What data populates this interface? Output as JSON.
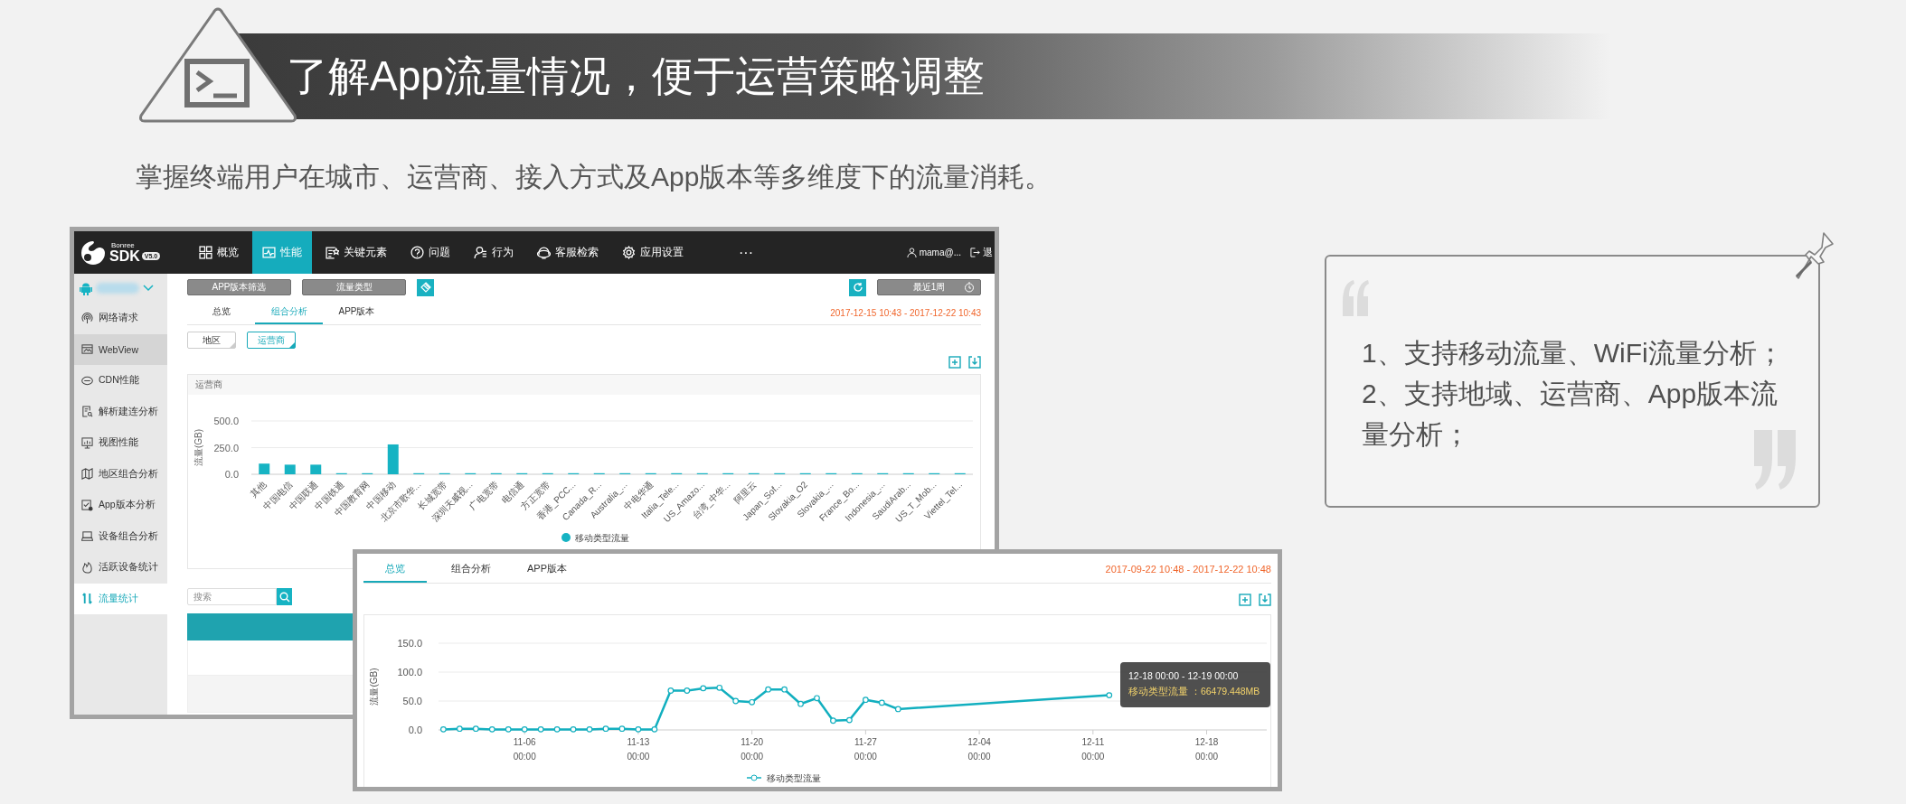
{
  "headline": {
    "title": "了解App流量情况，便于运营策略调整",
    "subtitle": "掌握终端用户在城市、运营商、接入方式及App版本等多维度下的流量消耗。"
  },
  "back_window": {
    "logo": {
      "brand": "Bonree",
      "product": "SDK",
      "version": "V5.0"
    },
    "nav": [
      {
        "label": "概览",
        "selected": false
      },
      {
        "label": "性能",
        "selected": true
      },
      {
        "label": "关键元素",
        "selected": false
      },
      {
        "label": "问题",
        "selected": false
      },
      {
        "label": "行为",
        "selected": false
      },
      {
        "label": "客服检索",
        "selected": false
      },
      {
        "label": "应用设置",
        "selected": false
      }
    ],
    "more": "···",
    "user": "mama@...",
    "logout": "退",
    "sidebar": {
      "items": [
        {
          "label": "网络请求",
          "selected": false,
          "hovered": false
        },
        {
          "label": "WebView",
          "selected": false,
          "hovered": true
        },
        {
          "label": "CDN性能",
          "selected": false,
          "hovered": false
        },
        {
          "label": "解析建连分析",
          "selected": false,
          "hovered": false
        },
        {
          "label": "视图性能",
          "selected": false,
          "hovered": false
        },
        {
          "label": "地区组合分析",
          "selected": false,
          "hovered": false
        },
        {
          "label": "App版本分析",
          "selected": false,
          "hovered": false
        },
        {
          "label": "设备组合分析",
          "selected": false,
          "hovered": false
        },
        {
          "label": "活跃设备统计",
          "selected": false,
          "hovered": false
        },
        {
          "label": "流量统计",
          "selected": true,
          "hovered": false
        }
      ]
    },
    "filters": [
      "APP版本筛选",
      "流量类型"
    ],
    "range": "最近1周",
    "tabs": [
      {
        "label": "总览",
        "selected": false
      },
      {
        "label": "组合分析",
        "selected": true
      },
      {
        "label": "APP版本",
        "selected": false
      }
    ],
    "date_range": "2017-12-15 10:43 - 2017-12-22 10:43",
    "chips": [
      {
        "label": "地区",
        "selected": false
      },
      {
        "label": "运营商",
        "selected": true
      }
    ],
    "chart_card": {
      "title": "运营商",
      "chart_data": {
        "type": "bar",
        "ylabel": "流量(GB)",
        "categories": [
          "其他",
          "中国电信",
          "中国联通",
          "中国铁通",
          "中国教育网",
          "中国移动",
          "北京市歌华...",
          "长城宽带",
          "深圳天威视...",
          "广电宽带",
          "电信通",
          "方正宽带",
          "香港_PCC...",
          "Canada_R...",
          "Australia_...",
          "中电华通",
          "Italia_Tele...",
          "US_Amazo...",
          "台湾_中华...",
          "阿里云",
          "Japan_Sof...",
          "Slovakia_O2",
          "Slovakia_...",
          "France_Bo...",
          "Indonesia_...",
          "SaudiArab...",
          "US_T_Mob...",
          "Viettel_Tel..."
        ],
        "series": [
          {
            "name": "移动类型流量",
            "color": "#16b3c3",
            "values": [
              100,
              90,
              90,
              10,
              10,
              280,
              10,
              10,
              10,
              10,
              10,
              10,
              10,
              10,
              10,
              10,
              10,
              10,
              10,
              10,
              10,
              10,
              10,
              10,
              10,
              10,
              10,
              10
            ]
          }
        ],
        "ylim": [
          0,
          500
        ],
        "yticks": [
          {
            "value": 0,
            "label": "0.0"
          },
          {
            "value": 250,
            "label": "250.0"
          },
          {
            "value": 500,
            "label": "500.0"
          }
        ]
      }
    },
    "search": {
      "placeholder": "搜索"
    }
  },
  "front_window": {
    "tabs": [
      {
        "label": "总览",
        "selected": true
      },
      {
        "label": "组合分析",
        "selected": false
      },
      {
        "label": "APP版本",
        "selected": false
      }
    ],
    "date_range": "2017-09-22 10:48 - 2017-12-22 10:48",
    "chart_data": {
      "type": "line",
      "ylabel": "流量(GB)",
      "categories": [
        null,
        null,
        null,
        null,
        null,
        "11-06 00:00",
        null,
        null,
        null,
        null,
        null,
        null,
        "11-13 00:00",
        null,
        null,
        null,
        null,
        null,
        null,
        "11-20 00:00",
        null,
        null,
        null,
        null,
        null,
        null,
        "11-27 00:00",
        null,
        null,
        null,
        null,
        null,
        null,
        "12-04 00:00",
        null,
        null,
        null,
        null,
        null,
        null,
        "12-11 00:00",
        null,
        null,
        null,
        null,
        null,
        null,
        "12-18 00:00",
        null,
        null,
        null
      ],
      "series": [
        {
          "name": "移动类型流量",
          "color": "#12afbf",
          "marker": "circle",
          "values": [
            1,
            2,
            2,
            1,
            1,
            1,
            1,
            1,
            1,
            1,
            2,
            2,
            1,
            1,
            68,
            68,
            72,
            73,
            50,
            48,
            70,
            70,
            45,
            55,
            16,
            17,
            52,
            47,
            36,
            null,
            null,
            null,
            null,
            null,
            null,
            null,
            null,
            null,
            null,
            null,
            null,
            60,
            null,
            null,
            null,
            null,
            null,
            null,
            null,
            null,
            null
          ]
        }
      ],
      "ylim": [
        0,
        150
      ],
      "yticks": [
        {
          "value": 0,
          "label": "0.0"
        },
        {
          "value": 50,
          "label": "50.0"
        },
        {
          "value": 100,
          "label": "100.0"
        },
        {
          "value": 150,
          "label": "150.0"
        }
      ]
    },
    "tooltip": {
      "title": "12-18 00:00 - 12-19 00:00",
      "series": "移动类型流量 ：",
      "value": "66479.448MB"
    }
  },
  "quote": {
    "lines": [
      "1、支持移动流量、WiFi流量分析；",
      "2、支持地域、运营商、App版本流量分析；"
    ]
  }
}
